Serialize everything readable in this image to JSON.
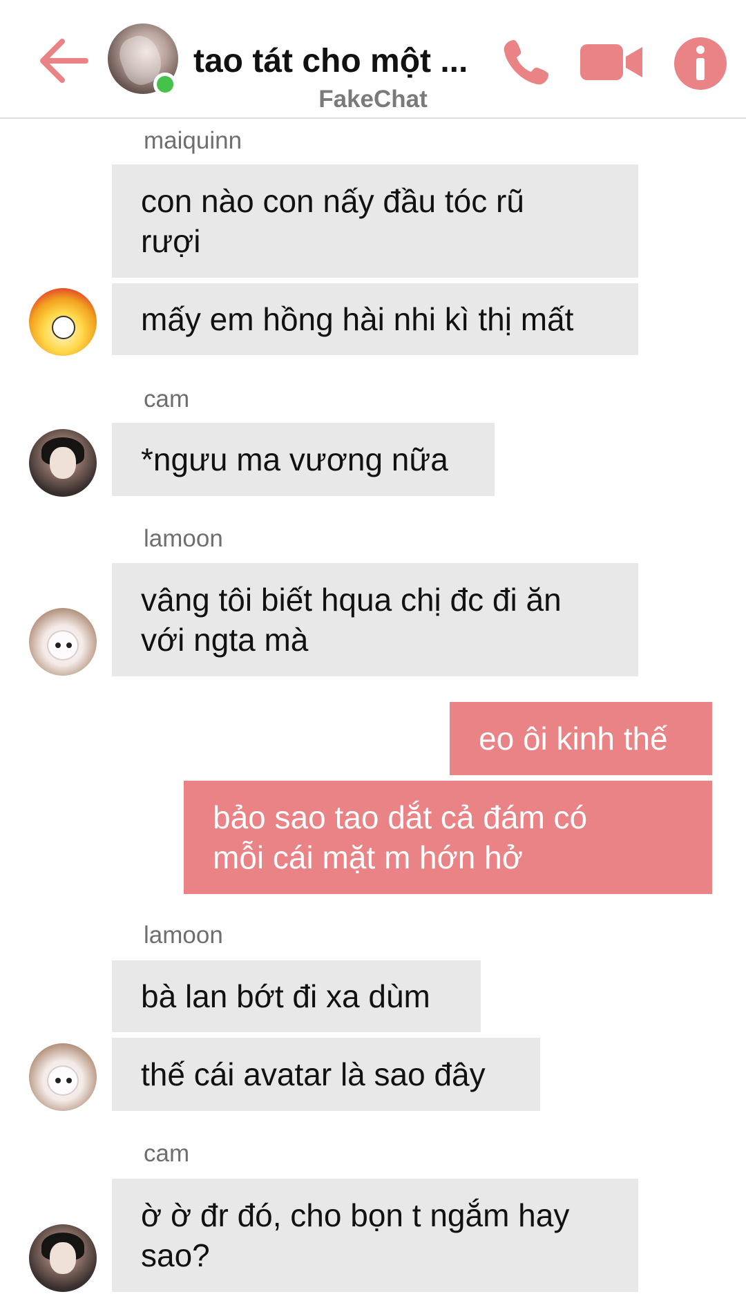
{
  "header": {
    "back_icon": "arrow-left-icon",
    "title": "tao tát cho một ...",
    "subtitle": "FakeChat",
    "online": true,
    "icons": [
      "phone-icon",
      "video-camera-icon",
      "info-icon"
    ],
    "accent_color": "#e98385"
  },
  "messages": [
    {
      "sender": "maiquinn",
      "lines": [
        "con nào con nấy đầu tóc rũ",
        "rượi"
      ]
    },
    {
      "lines": [
        "mấy em hồng hài nhi kì thị mất"
      ]
    },
    {
      "sender": "cam",
      "lines": [
        "*ngưu ma vương nữa"
      ]
    },
    {
      "sender": "lamoon",
      "lines": [
        "vâng tôi biết hqua chị đc đi ăn",
        "với ngta mà"
      ]
    },
    {
      "outgoing": true,
      "lines": [
        "eo ôi kinh thế"
      ]
    },
    {
      "outgoing": true,
      "lines": [
        "bảo sao tao dắt cả đám có",
        "mỗi cái mặt m hớn hở"
      ]
    },
    {
      "sender": "lamoon",
      "lines": [
        "bà lan bớt đi xa dùm"
      ]
    },
    {
      "lines": [
        "thế cái avatar là sao đây"
      ]
    },
    {
      "sender": "cam",
      "lines": [
        "ờ ờ đr đó, cho bọn t ngắm hay",
        "sao?"
      ]
    }
  ],
  "colors": {
    "incoming_bubble": "#e8e8e8",
    "outgoing_bubble": "#e98385",
    "online_dot": "#44c24a"
  }
}
